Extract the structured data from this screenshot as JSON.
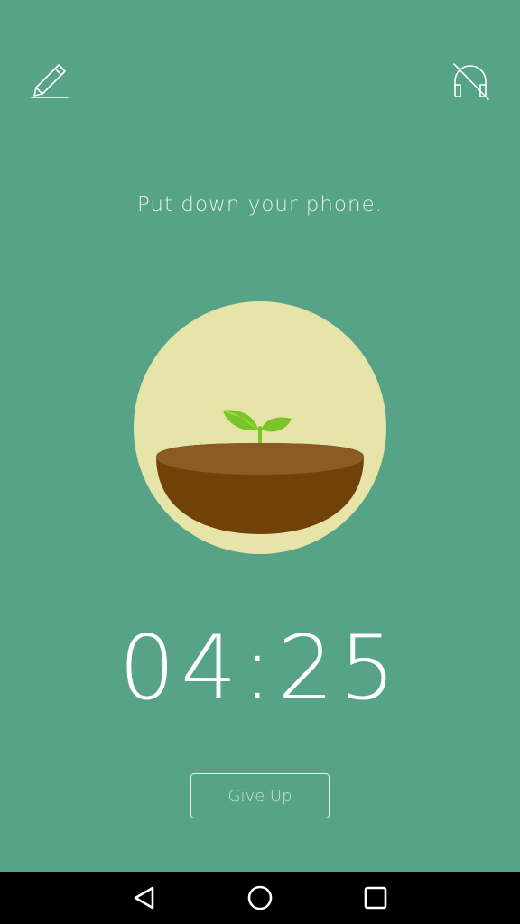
{
  "app": {
    "background_color": "#56a388",
    "header": {
      "edit_icon": "pencil-icon",
      "sound_icon": "headphones-muted-icon"
    },
    "message": "Put down your phone.",
    "plant": {
      "circle_color": "#e6e4a8",
      "pot_color": "#704207",
      "soil_color": "#8b5a25",
      "leaf_color": "#7bc52b",
      "stage": "sprout"
    },
    "timer": {
      "minutes": "04",
      "separator": ":",
      "seconds": "25"
    },
    "give_up_label": "Give Up"
  },
  "system_nav": {
    "back_icon": "triangle-back-icon",
    "home_icon": "circle-home-icon",
    "recents_icon": "square-recents-icon"
  }
}
